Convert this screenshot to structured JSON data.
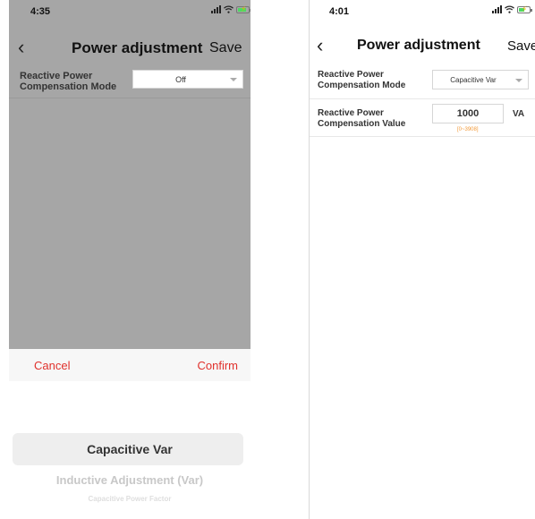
{
  "left_screen": {
    "status": {
      "time": "4:35"
    },
    "nav": {
      "title": "Power adjustment",
      "save_label": "Save"
    },
    "mode_row": {
      "label_line1": "Reactive Power",
      "label_line2": "Compensation Mode",
      "value": "Off"
    },
    "picker": {
      "cancel_label": "Cancel",
      "confirm_label": "Confirm",
      "options": [
        "Capacitive Var",
        "Inductive Adjustment (Var)",
        "Capacitive Power Factor"
      ],
      "selected_index": 0
    }
  },
  "right_screen": {
    "status": {
      "time": "4:01"
    },
    "nav": {
      "title": "Power adjustment",
      "save_label": "Save"
    },
    "mode_row": {
      "label_line1": "Reactive Power",
      "label_line2": "Compensation Mode",
      "value": "Capacitive Var"
    },
    "value_row": {
      "label_line1": "Reactive Power",
      "label_line2": "Compensation Value",
      "value": "1000",
      "range_hint": "[0~3908]",
      "unit": "VA"
    }
  },
  "colors": {
    "accent_red": "#e0312c",
    "range_orange": "#f29a3a",
    "overlay_gray": "#a6a6a6"
  },
  "icons": [
    "back-chevron-icon",
    "signal-icon",
    "wifi-icon",
    "battery-icon",
    "dropdown-caret-icon"
  ]
}
